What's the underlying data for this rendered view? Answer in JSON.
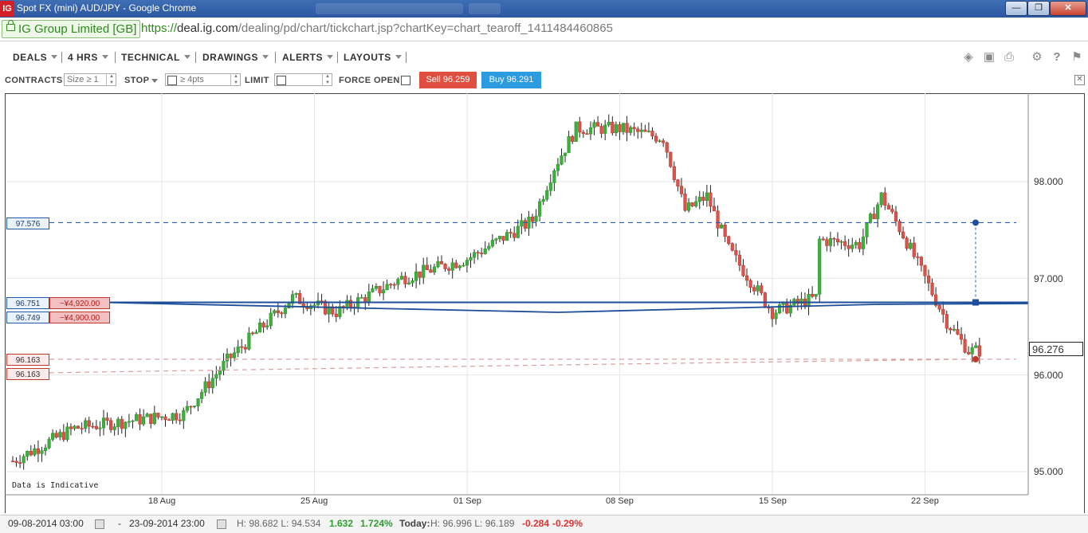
{
  "window": {
    "title": "Spot FX (mini) AUD/JPY - Google Chrome",
    "logo": "IG",
    "controls": [
      "minimize-icon",
      "maximize-icon",
      "close-icon"
    ]
  },
  "address": {
    "ev_label": "IG Group Limited [GB]",
    "url_scheme": "https://",
    "url_host": "deal.ig.com",
    "url_path": "/dealing/pd/chart/tickchart.jsp?chartKey=chart_tearoff_1411484460865"
  },
  "menu": {
    "deals": "DEALS",
    "interval": "4 HRS",
    "technical": "TECHNICAL",
    "drawings": "DRAWINGS",
    "alerts": "ALERTS",
    "layouts": "LAYOUTS",
    "tools": [
      "layers-icon",
      "image-icon",
      "print-icon",
      "gear-icon",
      "help-icon",
      "chat-icon"
    ]
  },
  "ticket": {
    "contracts_label": "CONTRACTS",
    "size_placeholder": "Size ≥ 1",
    "stop_label": "STOP",
    "stop_placeholder": "≥ 4pts",
    "limit_label": "LIMIT",
    "force_open_label": "FORCE OPEN",
    "sell_label": "Sell 96.259",
    "buy_label": "Buy 96.291"
  },
  "chart_data": {
    "type": "candlestick",
    "instrument": "Spot FX (mini) AUD/JPY",
    "interval": "4 HRS",
    "y_axis": {
      "ticks": [
        "98.000",
        "97.000",
        "96.000",
        "95.000"
      ],
      "range": [
        94.72,
        98.78
      ]
    },
    "x_axis": {
      "ticks": [
        "18 Aug",
        "25 Aug",
        "01 Sep",
        "08 Sep",
        "15 Sep",
        "22 Sep"
      ]
    },
    "gridlines": true,
    "last_price": "96.276",
    "annotation": "Data is Indicative",
    "trend_path": [
      [
        "09-08-2014",
        94.85
      ],
      [
        "14-08-2014",
        95.45
      ],
      [
        "19-08-2014",
        95.6
      ],
      [
        "21-08-2014",
        96.15
      ],
      [
        "24-08-2014",
        96.8
      ],
      [
        "26-08-2014",
        96.65
      ],
      [
        "29-08-2014",
        97.0
      ],
      [
        "01-09-2014",
        97.2
      ],
      [
        "04-09-2014",
        97.6
      ],
      [
        "05-09-2014",
        98.15
      ],
      [
        "06-09-2014",
        98.55
      ],
      [
        "08-09-2014",
        98.55
      ],
      [
        "10-09-2014",
        98.45
      ],
      [
        "11-09-2014",
        97.7
      ],
      [
        "12-09-2014",
        97.85
      ],
      [
        "13-09-2014",
        97.3
      ],
      [
        "15-09-2014",
        96.65
      ],
      [
        "17-09-2014",
        96.8
      ],
      [
        "17-09-2014",
        97.4
      ],
      [
        "19-09-2014",
        97.35
      ],
      [
        "20-09-2014",
        97.85
      ],
      [
        "21-09-2014",
        97.45
      ],
      [
        "22-09-2014",
        97.0
      ],
      [
        "23-09-2014",
        96.55
      ],
      [
        "24-09-2014",
        96.25
      ]
    ],
    "order_levels": [
      {
        "label": "97.576",
        "value": 97.576,
        "style": "blue-dashed"
      },
      {
        "label": "96.751",
        "value": 96.751,
        "pl": "−¥4,920.00",
        "style": "blue-solid"
      },
      {
        "label": "96.749",
        "value": 96.749,
        "pl": "−¥4,900.00",
        "style": "blue-solid"
      },
      {
        "label": "96.163",
        "value": 96.163,
        "style": "red-dashed"
      },
      {
        "label": "96.163",
        "value": 96.163,
        "style": "red-dashed"
      }
    ]
  },
  "status": {
    "from": "09-08-2014 03:00",
    "dash": "-",
    "to": "23-09-2014 23:00",
    "hl": "H: 98.682   L: 94.534",
    "change": "1.632",
    "change_pct": "1.724%",
    "today_label": "Today:",
    "today_hl": "H: 96.996   L: 96.189",
    "today_change": "-0.284",
    "today_change_pct": "-0.29%"
  }
}
